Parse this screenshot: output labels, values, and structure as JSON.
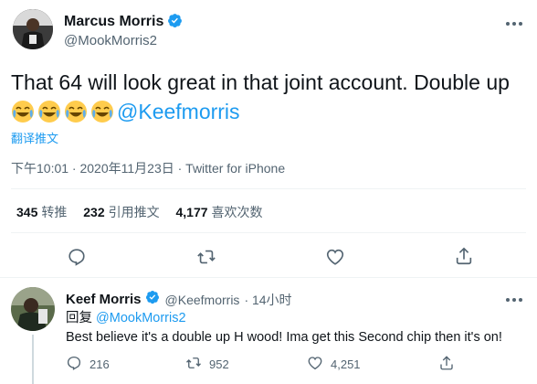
{
  "tweet": {
    "author_name": "Marcus Morris",
    "author_handle": "@MookMorris2",
    "text_line1": "That 64 will look great in that joint account. Double up",
    "mention": "@Keefmorris",
    "emoji_count": 4,
    "translate_label": "翻译推文",
    "timestamp": "下午10:01 · 2020年11月23日 · Twitter for iPhone",
    "stats": {
      "retweets_value": "345",
      "retweets_label": "转推",
      "quotes_value": "232",
      "quotes_label": "引用推文",
      "likes_value": "4,177",
      "likes_label": "喜欢次数"
    },
    "actions": [
      "reply-icon",
      "retweet-icon",
      "like-icon",
      "share-icon"
    ]
  },
  "reply": {
    "author_name": "Keef Morris",
    "author_handle": "@Keefmorris",
    "time": "· 14小时",
    "replying_prefix": "回复",
    "replying_to": "@MookMorris2",
    "text": "Best believe it's a double up H wood! Ima get this Second chip then it's on!",
    "stats": {
      "replies": "216",
      "retweets": "952",
      "likes": "4,251"
    }
  },
  "colors": {
    "accent": "#1d9bf0",
    "secondary_text": "#536471",
    "divider": "#eff3f4"
  }
}
